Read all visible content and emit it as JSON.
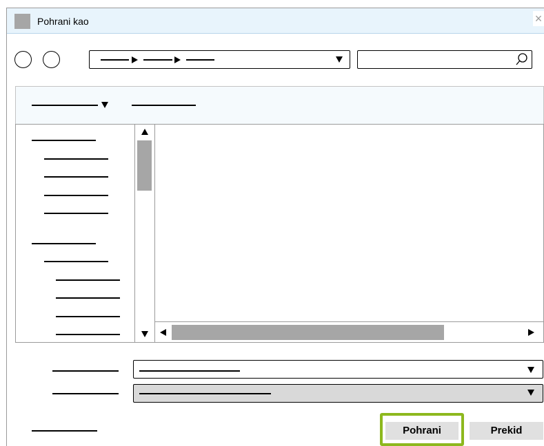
{
  "window": {
    "title": "Pohrani kao",
    "close_glyph": "×"
  },
  "search": {
    "icon": "search-icon"
  },
  "buttons": {
    "save": "Pohrani",
    "cancel": "Prekid"
  },
  "colors": {
    "titlebar": "#e8f4fc",
    "save_highlight": "#8db81e",
    "scroll_thumb": "#a6a6a6",
    "button_bg": "#e0e0e0"
  }
}
